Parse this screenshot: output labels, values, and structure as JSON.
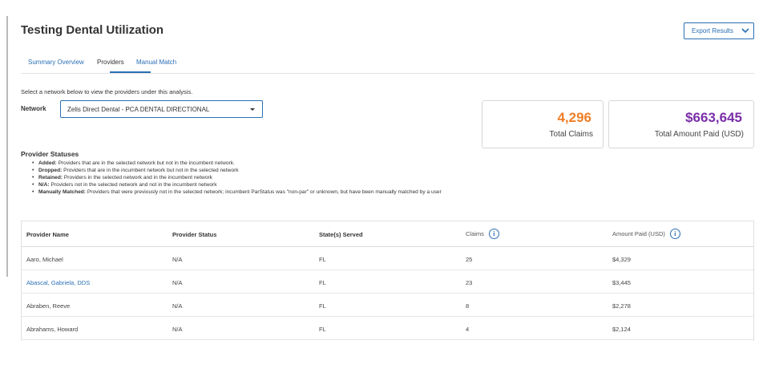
{
  "page": {
    "title": "Testing Dental Utilization"
  },
  "toolbar": {
    "export_label": "Export Results",
    "export_icon": "chevron-down-icon",
    "accent": "#2a6fb5"
  },
  "tabs": [
    {
      "label": "Summary Overview",
      "active": false
    },
    {
      "label": "Providers",
      "active": true
    },
    {
      "label": "Manual Match",
      "active": false
    }
  ],
  "instructions": "Select a network below to view the providers under this analysis.",
  "network": {
    "label": "Network",
    "selected": "Zelis Direct Dental - PCA DENTAL DIRECTIONAL"
  },
  "summary": {
    "claims": {
      "value": "4,296",
      "label": "Total Claims",
      "color": "#f07e26"
    },
    "paid": {
      "value": "$663,645",
      "label": "Total Amount Paid (USD)",
      "color": "#7a2fa8"
    }
  },
  "statuses": {
    "title": "Provider Statuses",
    "items": [
      {
        "term": "Added:",
        "desc": "Providers that are in the selected network but not in the incumbent network."
      },
      {
        "term": "Dropped:",
        "desc": "Providers that are in the incumbent network but not in the selected network"
      },
      {
        "term": "Retained:",
        "desc": "Providers in the selected network and in the incumbent network"
      },
      {
        "term": "N/A:",
        "desc": "Providers not in the selected network and not in the incumbent network"
      },
      {
        "term": "Manually Matched:",
        "desc": "Providers that were previously not in the selected network; incumbent ParStatus was \"non-par\" or unknown, but have been manually matched by a user"
      }
    ]
  },
  "table": {
    "headers": [
      "Provider Name",
      "Provider Status",
      "State(s) Served",
      "Claims",
      "Amount Paid (USD)"
    ],
    "rows": [
      {
        "name": "Aaro, Michael",
        "status": "N/A",
        "state": "FL",
        "claims": "25",
        "paid": "$4,329",
        "link": false
      },
      {
        "name": "Abascal, Gabriela, DDS",
        "status": "N/A",
        "state": "FL",
        "claims": "23",
        "paid": "$3,445",
        "link": true
      },
      {
        "name": "Abraben, Reeve",
        "status": "N/A",
        "state": "FL",
        "claims": "8",
        "paid": "$2,278",
        "link": false
      },
      {
        "name": "Abrahams, Howard",
        "status": "N/A",
        "state": "FL",
        "claims": "4",
        "paid": "$2,124",
        "link": false
      }
    ]
  }
}
